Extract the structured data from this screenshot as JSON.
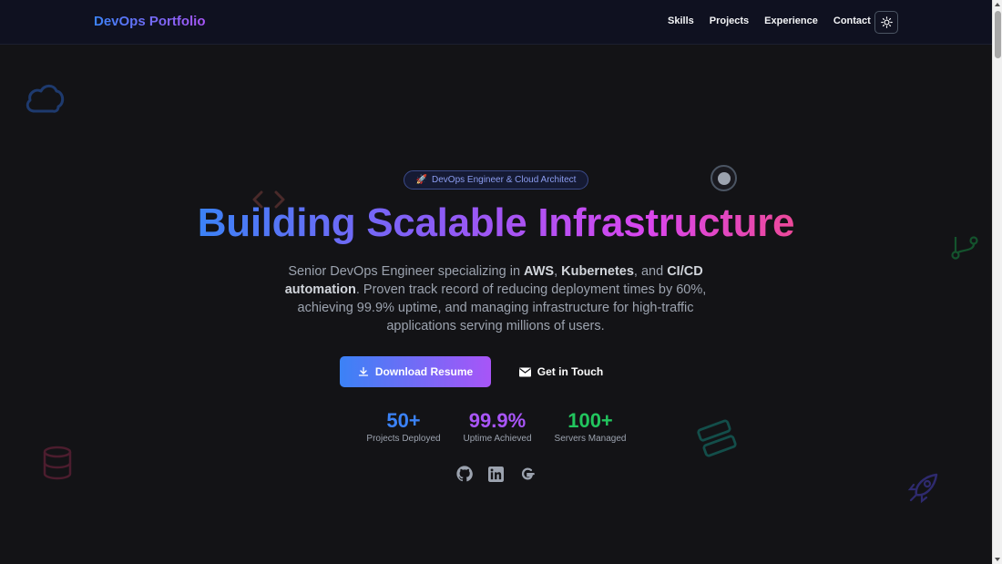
{
  "nav": {
    "brand": "DevOps Portfolio",
    "links": [
      "Skills",
      "Projects",
      "Experience",
      "Contact"
    ],
    "theme_toggle_icon": "sun-icon"
  },
  "hero": {
    "badge_icon": "rocket-icon",
    "badge": "DevOps Engineer & Cloud Architect",
    "title": "Building Scalable Infrastructure",
    "description": {
      "p1": "Senior DevOps Engineer specializing in ",
      "aws": "AWS",
      "p2": ", ",
      "k8s": "Kubernetes",
      "p3": ", and ",
      "cicd": "CI/CD automation",
      "p4": ". Proven track record of reducing deployment times by 60%, achieving 99.9% uptime, and managing infrastructure for high-traffic applications serving millions of users."
    },
    "primary_button": "Download Resume",
    "secondary_button": "Get in Touch"
  },
  "stats": [
    {
      "value": "50+",
      "label": "Projects Deployed",
      "color": "#3b82f6"
    },
    {
      "value": "99.9%",
      "label": "Uptime Achieved",
      "color": "#a855f7"
    },
    {
      "value": "100+",
      "label": "Servers Managed",
      "color": "#22c55e"
    }
  ],
  "social_icons": [
    "github-icon",
    "linkedin-icon",
    "google-icon"
  ],
  "colors": {
    "accent_blue": "#3b82f6",
    "accent_purple": "#a855f7",
    "accent_pink": "#ec4899",
    "background": "#131316"
  }
}
